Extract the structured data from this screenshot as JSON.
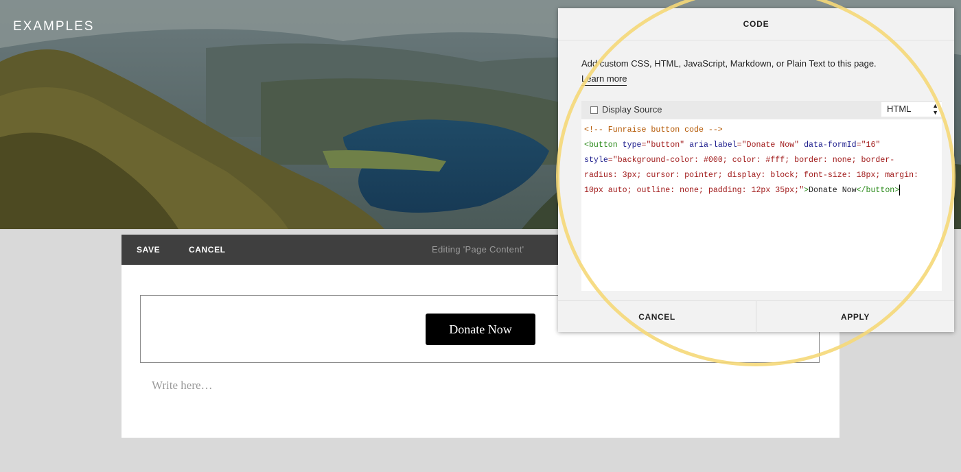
{
  "site": {
    "title": "EXAMPLES"
  },
  "editor_bar": {
    "save_label": "SAVE",
    "cancel_label": "CANCEL",
    "status_text": "Editing 'Page Content'"
  },
  "content": {
    "donate_button_label": "Donate Now",
    "write_placeholder": "Write here…"
  },
  "code_dialog": {
    "title": "CODE",
    "description": "Add custom CSS, HTML, JavaScript, Markdown, or Plain Text to this page.",
    "learn_more": "Learn more",
    "display_source_label": "Display Source",
    "display_source_checked": false,
    "language_selected": "HTML",
    "code_lines": {
      "l1": "<!-- Funraise button code -->",
      "l2_tag_open": "<button",
      "l2_attr1": " type",
      "l2_val1": "=\"button\"",
      "l2_attr2": " aria-label",
      "l2_val2": "=\"Donate Now\"",
      "l2_attr3": " data-formId",
      "l2_val3": "=\"16\"",
      "l3_attr": "style",
      "l3_val": "=\"background-color: #000; color: #fff; border: none; border-",
      "l4_val": "radius: 3px; cursor: pointer; display: block; font-size: 18px; margin:",
      "l5_val": "10px auto; outline: none; padding: 12px 35px;\"",
      "l5_gt": ">",
      "l5_text": "Donate Now",
      "l5_close": "</button>"
    },
    "cancel_label": "CANCEL",
    "apply_label": "APPLY"
  },
  "colors": {
    "highlight_circle": "#f5d878",
    "toolbar_bg": "#3f3f3f",
    "donate_button_bg": "#000000"
  }
}
